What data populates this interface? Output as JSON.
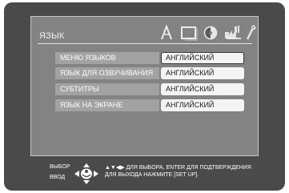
{
  "menu": {
    "title": "ЯЗЫК",
    "icons": [
      "font-a-icon",
      "display-frame-icon",
      "speaker-icon",
      "palette-brush-icon",
      "wrench-icon"
    ],
    "rows": [
      {
        "label": "МЕНЮ ЯЗЫКОВ",
        "value": "АНГЛИЙСКИЙ",
        "selected": true
      },
      {
        "label": "ЯЗЫК ДЛЯ ОЗВУЧИВАНИЯ",
        "value": "АНГЛИЙСКИЙ",
        "selected": false
      },
      {
        "label": "СУБТИТРЫ",
        "value": "АНГЛИЙСКИЙ",
        "selected": false
      },
      {
        "label": "ЯЗЫК НА ЭКРАНЕ",
        "value": "АНГЛИЙСКИЙ",
        "selected": false
      }
    ]
  },
  "footer": {
    "select_word": "ВЫБОР",
    "enter_word": "ВВОД",
    "help_line1": "▲▼◀▶ ДЛЯ ВЫБОРА, ENTER ДЛЯ ПОДТВЕРЖДЕНИЯ",
    "help_line2": "ДЛЯ ВЫХОДА НАЖМИТЕ [SET UP]."
  },
  "colors": {
    "screen": "#4a4a4a",
    "panel": "#838383",
    "label_bg": "#a2a2a2",
    "value_bg": "#f4f4f4"
  }
}
